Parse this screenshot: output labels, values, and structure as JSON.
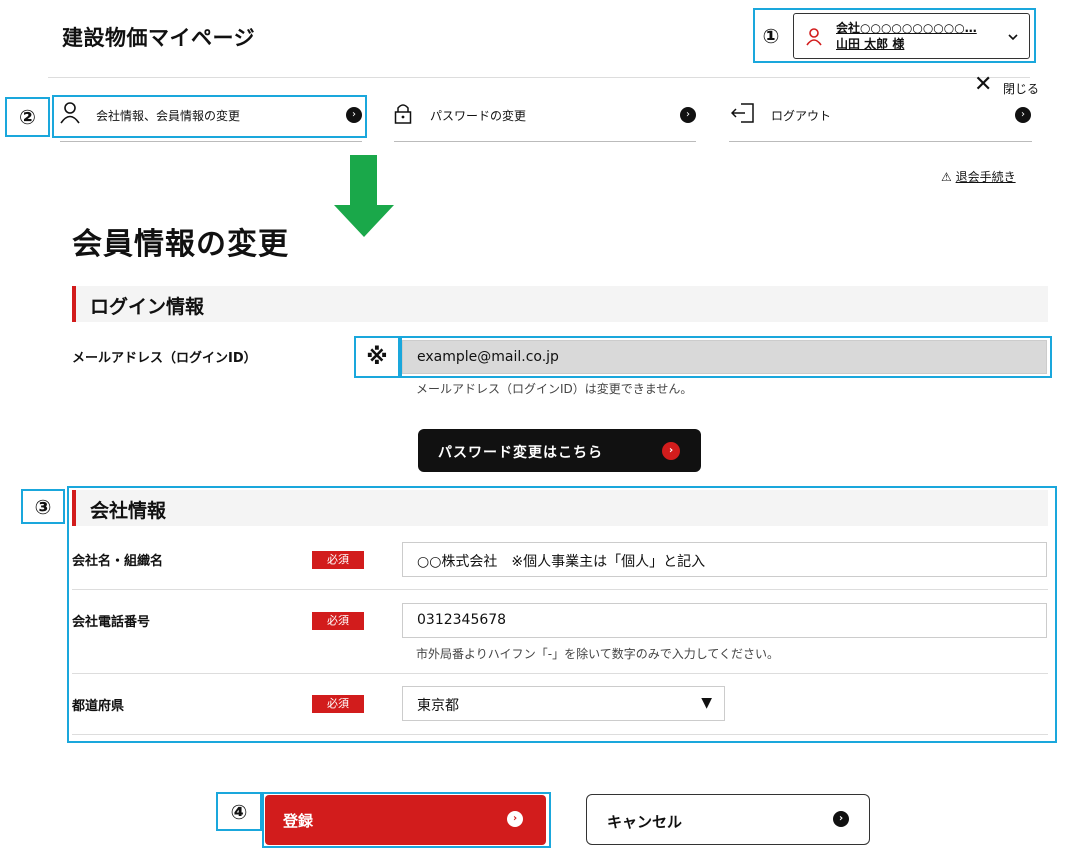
{
  "brand": "建設物価マイページ",
  "user": {
    "company": "会社○○○○○○○○○○…",
    "name": "山田 太郎 様"
  },
  "close_label": "閉じる",
  "nav": [
    {
      "label": "会社情報、会員情報の変更"
    },
    {
      "label": "パスワードの変更"
    },
    {
      "label": "ログアウト"
    }
  ],
  "withdraw_label": "退会手続き",
  "page_title": "会員情報の変更",
  "login_section": {
    "title": "ログイン情報",
    "email_label": "メールアドレス（ログインID）",
    "email_value": "example@mail.co.jp",
    "email_note": "メールアドレス（ログインID）は変更できません。",
    "password_button": "パスワード変更はこちら"
  },
  "company_section": {
    "title": "会社情報",
    "required_badge": "必須",
    "fields": [
      {
        "label": "会社名・組織名",
        "value": "○○株式会社　※個人事業主は「個人」と記入"
      },
      {
        "label": "会社電話番号",
        "value": "0312345678",
        "note": "市外局番よりハイフン「-」を除いて数字のみで入力してください。"
      },
      {
        "label": "都道府県",
        "value": "東京都"
      }
    ]
  },
  "buttons": {
    "register": "登録",
    "cancel": "キャンセル"
  },
  "callouts": {
    "c1": "①",
    "c2": "②",
    "c3": "③",
    "c4": "④",
    "note_mark": "※"
  },
  "colors": {
    "accent_red": "#d21c1c",
    "callout_blue": "#1aa7dc",
    "arrow_green": "#1aa84a"
  }
}
